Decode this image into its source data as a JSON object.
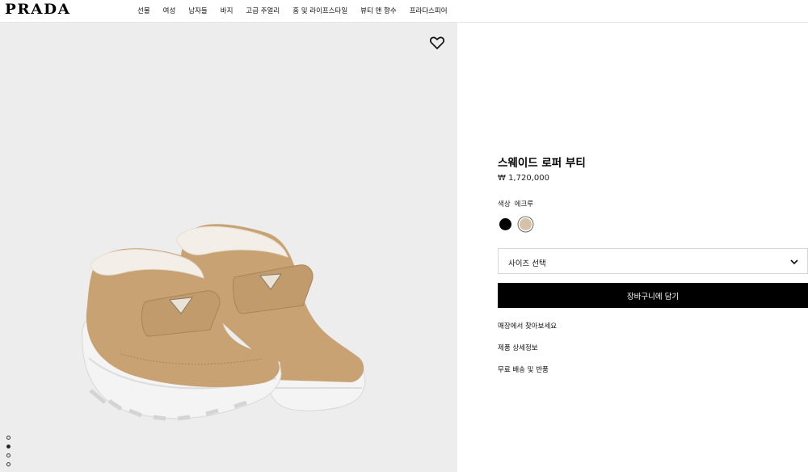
{
  "brand": {
    "logo": "PRADA"
  },
  "nav": {
    "items": [
      {
        "label": "선물"
      },
      {
        "label": "여성"
      },
      {
        "label": "남자들"
      },
      {
        "label": "바지"
      },
      {
        "label": "고급 주얼리"
      },
      {
        "label": "홈 및 라이프스타일"
      },
      {
        "label": "뷰티 앤 향수"
      },
      {
        "label": "프라다스피어"
      }
    ]
  },
  "product": {
    "title": "스웨이드 로퍼 부티",
    "price": "₩ 1,720,000",
    "color_label": "색상",
    "color_value": "에크루",
    "swatches": [
      {
        "name": "black",
        "color": "#000000"
      },
      {
        "name": "ecru",
        "color": "#d7c2a8",
        "selected": true
      }
    ],
    "size_placeholder": "사이즈 선택",
    "add_to_cart": "장바구니에 담기",
    "links": [
      "매장에서 찾아보세요",
      "제품 상세정보",
      "무료 배송 및 반품"
    ]
  },
  "gallery": {
    "image_count": 4,
    "active_index": 1
  },
  "icons": {
    "wishlist": "heart-icon",
    "select": "chevron-down-icon"
  }
}
